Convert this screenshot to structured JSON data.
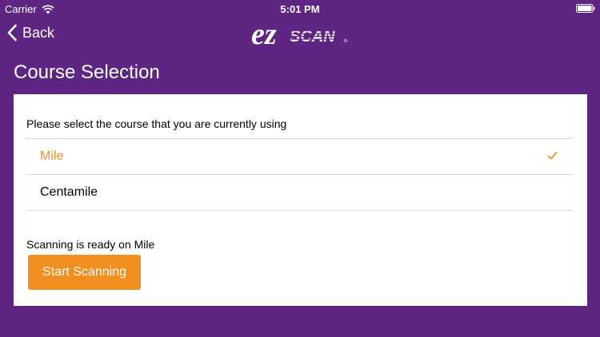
{
  "status_bar": {
    "carrier": "Carrier",
    "time": "5:01 PM"
  },
  "nav": {
    "back_label": "Back",
    "logo_ez": "ez",
    "logo_scan": "SCAN"
  },
  "page": {
    "title": "Course Selection",
    "prompt": "Please select the course that you are currently using",
    "courses": [
      {
        "label": "Mile",
        "selected": true
      },
      {
        "label": "Centamile",
        "selected": false
      }
    ],
    "status_text": "Scanning is ready on Mile",
    "start_button_label": "Start Scanning"
  },
  "colors": {
    "background": "#5e2583",
    "accent": "#f18f21",
    "card": "#ffffff"
  },
  "icons": {
    "wifi": "wifi-icon",
    "battery": "battery-icon",
    "back": "back-chevron-icon",
    "check": "checkmark-icon"
  }
}
